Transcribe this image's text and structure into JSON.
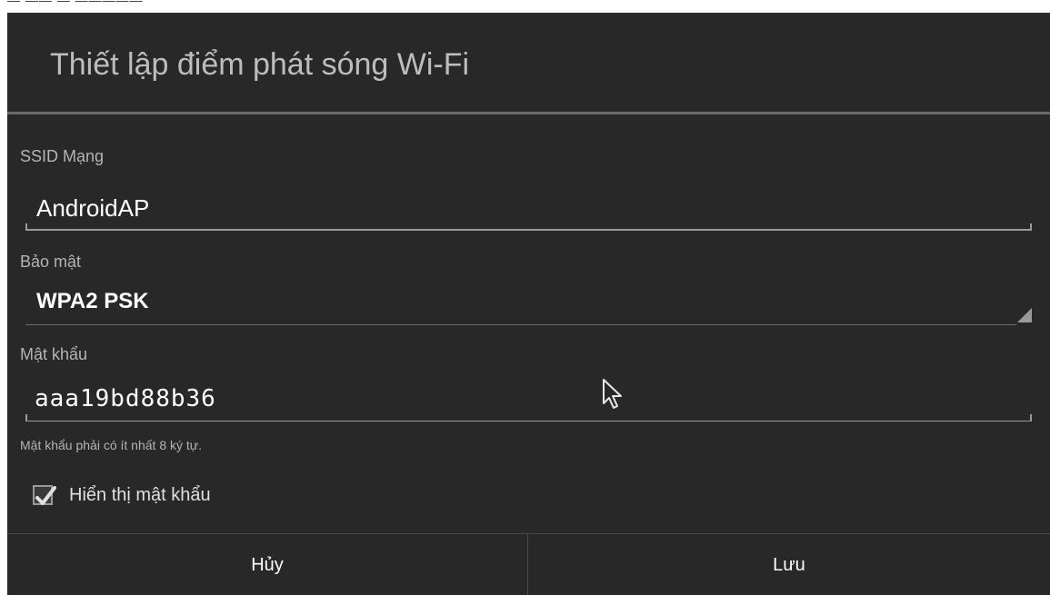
{
  "top_strip_text": "— —— — —————",
  "dialog": {
    "title": "Thiết lập điểm phát sóng Wi-Fi"
  },
  "ssid": {
    "label": "SSID Mạng",
    "value": "AndroidAP"
  },
  "security": {
    "label": "Bảo mật",
    "value": "WPA2 PSK"
  },
  "password": {
    "label": "Mật khẩu",
    "value": "aaa19bd88b36",
    "hint": "Mật khẩu phải có ít nhất 8 ký tự."
  },
  "show_password": {
    "label": "Hiển thị mật khẩu",
    "checked": true
  },
  "buttons": {
    "cancel_label": "Hủy",
    "save_label": "Lưu"
  },
  "colors": {
    "dialog_background": "#282828",
    "divider": "#6a6a6a",
    "text_primary": "#ffffff",
    "text_secondary": "#b4b4b4"
  },
  "icons": {
    "checkbox": "check-mark-icon",
    "spinner": "spinner-triangle-icon",
    "cursor": "mouse-pointer-icon"
  }
}
